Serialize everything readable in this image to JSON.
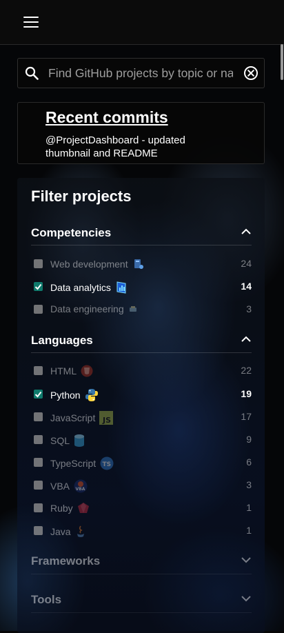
{
  "search": {
    "placeholder": "Find GitHub projects by topic or name"
  },
  "recent_commits": {
    "title": "Recent commits",
    "text": "@ProjectDashboard - updated thumbnail and README"
  },
  "filter": {
    "title": "Filter projects",
    "competencies": {
      "label": "Competencies",
      "expanded": true,
      "items": [
        {
          "label": "Web development",
          "count": "24",
          "checked": false,
          "icon": "web-development-icon"
        },
        {
          "label": "Data analytics",
          "count": "14",
          "checked": true,
          "icon": "data-analytics-icon"
        },
        {
          "label": "Data engineering",
          "count": "3",
          "checked": false,
          "icon": "data-engineering-icon"
        }
      ]
    },
    "languages": {
      "label": "Languages",
      "expanded": true,
      "items": [
        {
          "label": "HTML",
          "count": "22",
          "checked": false,
          "icon": "html-icon"
        },
        {
          "label": "Python",
          "count": "19",
          "checked": true,
          "icon": "python-icon"
        },
        {
          "label": "JavaScript",
          "count": "17",
          "checked": false,
          "icon": "javascript-icon",
          "icon_text": "JS"
        },
        {
          "label": "SQL",
          "count": "9",
          "checked": false,
          "icon": "database-icon"
        },
        {
          "label": "TypeScript",
          "count": "6",
          "checked": false,
          "icon": "typescript-icon",
          "icon_text": "TS"
        },
        {
          "label": "VBA",
          "count": "3",
          "checked": false,
          "icon": "vba-icon",
          "icon_text": "VBA"
        },
        {
          "label": "Ruby",
          "count": "1",
          "checked": false,
          "icon": "ruby-icon"
        },
        {
          "label": "Java",
          "count": "1",
          "checked": false,
          "icon": "java-icon"
        }
      ]
    },
    "frameworks": {
      "label": "Frameworks",
      "expanded": false
    },
    "tools": {
      "label": "Tools",
      "expanded": false
    }
  },
  "colors": {
    "checkbox_checked": "#0f7a6c",
    "checkbox_unchecked": "#8e8e8e",
    "javascript": "#a8b94a",
    "python_blue": "#3776ab",
    "python_yellow": "#ffd43b",
    "html_red": "#b03222",
    "typescript": "#3178c6",
    "ruby": "#9b1b2c"
  }
}
